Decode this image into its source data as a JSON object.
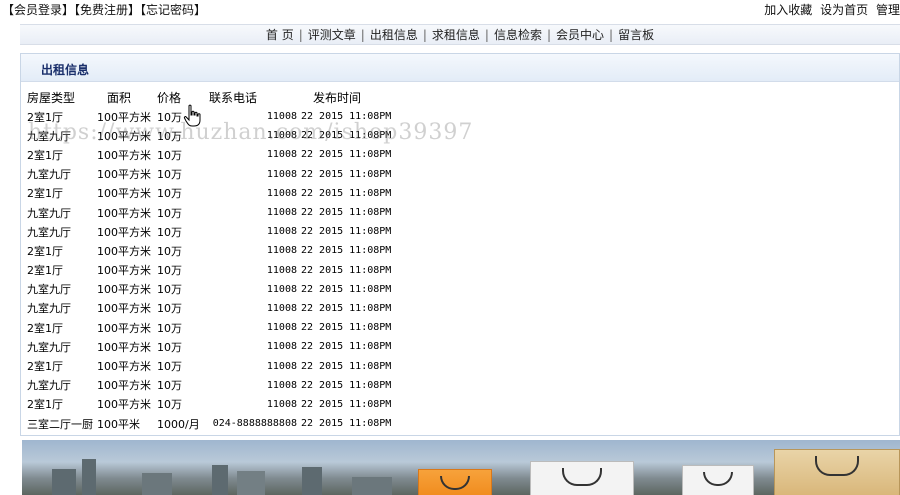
{
  "topbar": {
    "left_links": [
      "【会员登录】",
      "【免费注册】",
      "【忘记密码】"
    ],
    "right_links": [
      "加入收藏",
      "设为首页",
      "管理"
    ]
  },
  "nav": {
    "items": [
      "首 页",
      "评测文章",
      "出租信息",
      "求租信息",
      "信息检索",
      "会员中心",
      "留言板"
    ]
  },
  "panel": {
    "title": "出租信息",
    "columns": [
      "房屋类型",
      "面积",
      "价格",
      "联系电话",
      "发布时间"
    ],
    "rows": [
      {
        "type": "2室1厅",
        "area": "100平方米",
        "price": "10万",
        "phone": "11008",
        "time": "22 2015 11:08PM"
      },
      {
        "type": "九室九厅",
        "area": "100平方米",
        "price": "10万",
        "phone": "11008",
        "time": "22 2015 11:08PM"
      },
      {
        "type": "2室1厅",
        "area": "100平方米",
        "price": "10万",
        "phone": "11008",
        "time": "22 2015 11:08PM"
      },
      {
        "type": "九室九厅",
        "area": "100平方米",
        "price": "10万",
        "phone": "11008",
        "time": "22 2015 11:08PM"
      },
      {
        "type": "2室1厅",
        "area": "100平方米",
        "price": "10万",
        "phone": "11008",
        "time": "22 2015 11:08PM"
      },
      {
        "type": "九室九厅",
        "area": "100平方米",
        "price": "10万",
        "phone": "11008",
        "time": "22 2015 11:08PM"
      },
      {
        "type": "九室九厅",
        "area": "100平方米",
        "price": "10万",
        "phone": "11008",
        "time": "22 2015 11:08PM"
      },
      {
        "type": "2室1厅",
        "area": "100平方米",
        "price": "10万",
        "phone": "11008",
        "time": "22 2015 11:08PM"
      },
      {
        "type": "2室1厅",
        "area": "100平方米",
        "price": "10万",
        "phone": "11008",
        "time": "22 2015 11:08PM"
      },
      {
        "type": "九室九厅",
        "area": "100平方米",
        "price": "10万",
        "phone": "11008",
        "time": "22 2015 11:08PM"
      },
      {
        "type": "九室九厅",
        "area": "100平方米",
        "price": "10万",
        "phone": "11008",
        "time": "22 2015 11:08PM"
      },
      {
        "type": "2室1厅",
        "area": "100平方米",
        "price": "10万",
        "phone": "11008",
        "time": "22 2015 11:08PM"
      },
      {
        "type": "九室九厅",
        "area": "100平方米",
        "price": "10万",
        "phone": "11008",
        "time": "22 2015 11:08PM"
      },
      {
        "type": "2室1厅",
        "area": "100平方米",
        "price": "10万",
        "phone": "11008",
        "time": "22 2015 11:08PM"
      },
      {
        "type": "九室九厅",
        "area": "100平方米",
        "price": "10万",
        "phone": "11008",
        "time": "22 2015 11:08PM"
      },
      {
        "type": "2室1厅",
        "area": "100平方米",
        "price": "10万",
        "phone": "11008",
        "time": "22 2015 11:08PM"
      },
      {
        "type": "三室二厅一厨",
        "area": "100平米",
        "price": "1000/月",
        "phone": "024-8888888808",
        "time": "22 2015 11:08PM"
      }
    ]
  },
  "watermark": "https://www.huzhan.com/ishop39397",
  "colors": {
    "panel_title": "#1a2f6b",
    "panel_border": "#c9d6e6",
    "nav_bg": "#e9eef6"
  }
}
